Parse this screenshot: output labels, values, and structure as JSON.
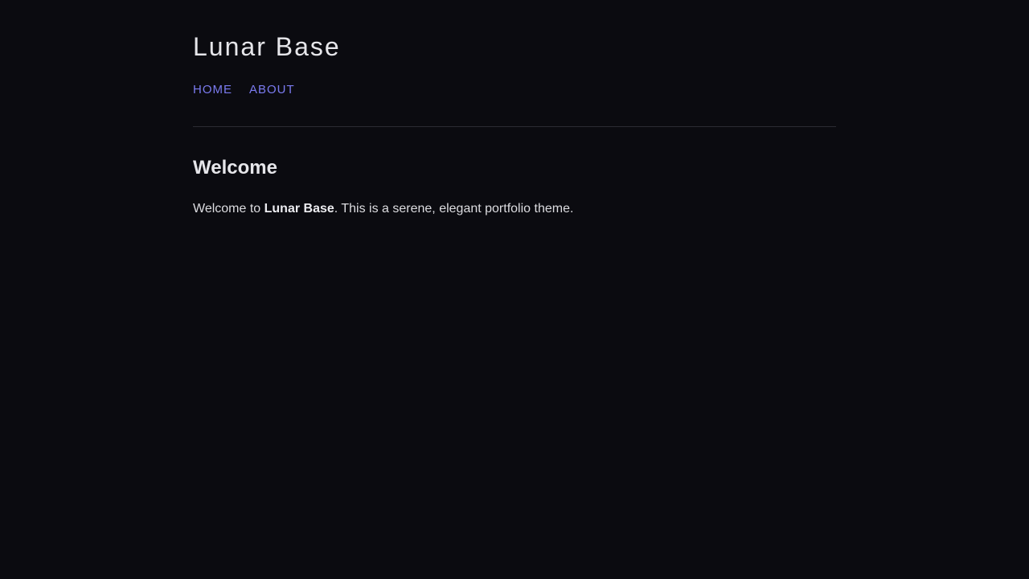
{
  "site": {
    "title": "Lunar Base"
  },
  "nav": {
    "items": [
      {
        "label": "Home"
      },
      {
        "label": "About"
      }
    ]
  },
  "main": {
    "heading": "Welcome",
    "intro": {
      "before": "Welcome to ",
      "bold": "Lunar Base",
      "after": ". This is a serene, elegant portfolio theme."
    }
  },
  "colors": {
    "background": "#0b0b10",
    "text": "#e6e6ea",
    "link": "#7b7bf0",
    "divider": "#2c2c33"
  }
}
